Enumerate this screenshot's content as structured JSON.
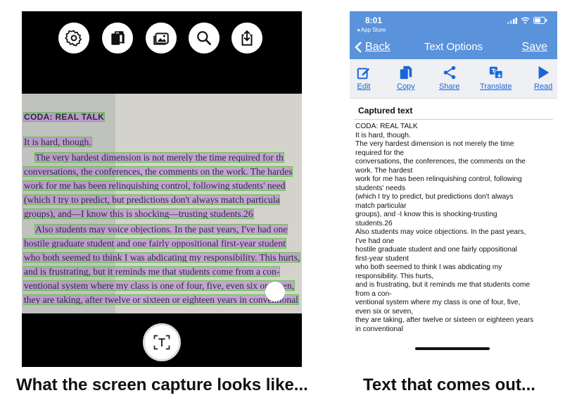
{
  "left_phone": {
    "toolbar_icons": [
      "gear-icon",
      "copy-pages-icon",
      "photo-icon",
      "magnifier-icon",
      "share-upload-icon"
    ],
    "capture_icon": "text-scan-icon",
    "viewfinder_lines": [
      "CODA: REAL TALK",
      "It is hard, though.",
      "The very hardest dimension is not merely the time required for th",
      "conversations, the conferences, the comments on the work. The hardes",
      "work for me has been relinquishing control, following students' need",
      "(which I try to predict, but predictions don't always match particula",
      "groups), and—I know this is shocking—trusting students.26",
      "Also students may voice objections. In the past years, I've had one",
      "hostile graduate student and one fairly oppositional first-year student",
      "who both seemed to think I was abdicating my responsibility. This hurts,",
      "and is frustrating, but it reminds me that students come from a con-",
      "ventional system where my class is one of four, five, even six or seven,",
      "they are taking, after twelve or sixteen or eighteen years in conventional"
    ]
  },
  "right_phone": {
    "status": {
      "time": "8:01",
      "back_app": "◂ App Store"
    },
    "nav": {
      "back": "Back",
      "title": "Text Options",
      "save": "Save"
    },
    "actions": [
      {
        "label": "Edit",
        "icon": "edit-icon"
      },
      {
        "label": "Copy",
        "icon": "copy-icon"
      },
      {
        "label": "Share",
        "icon": "share-icon"
      },
      {
        "label": "Translate",
        "icon": "translate-icon"
      },
      {
        "label": "Read",
        "icon": "play-icon"
      }
    ],
    "section_title": "Captured text",
    "captured_lines": [
      "CODA: REAL TALK",
      "It is hard, though.",
      "The very hardest dimension is not merely the time",
      "required for the",
      "conversations, the conferences, the comments on the",
      "work. The hardest",
      "work for me has been relinquishing control, following",
      "students' needs",
      "(which I try to predict, but predictions don't always",
      "match particular",
      "groups), and -I know this is shocking-trusting",
      "students.26",
      "Also students may voice objections. In the past years,",
      "I've had one",
      "hostile graduate student and one fairly oppositional",
      "first-year student",
      "who both seemed to think I was abdicating my",
      "responsibility. This hurts,",
      "and is frustrating, but it reminds me that students come",
      "from a con-",
      "ventional system where my class is one of four, five,",
      "even six or seven,",
      "they are taking, after twelve or sixteen or eighteen years",
      "in conventional"
    ]
  },
  "captions": {
    "left": "What the screen capture looks like...",
    "right": "Text that comes out..."
  },
  "colors": {
    "nav_blue": "#5a93dc",
    "link_blue": "#1b66d6",
    "highlight": "#be78dc",
    "outline": "#5ac83c"
  }
}
